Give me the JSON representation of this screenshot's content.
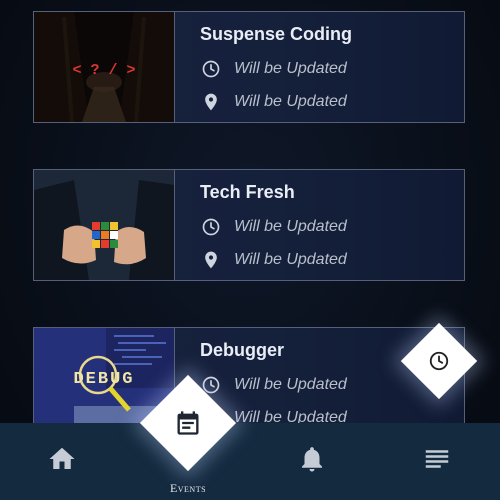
{
  "events": [
    {
      "title": "Suspense Coding",
      "time": "Will be Updated",
      "location": "Will be Updated",
      "thumb_text": "< ? / >"
    },
    {
      "title": "Tech Fresh",
      "time": "Will be Updated",
      "location": "Will be Updated"
    },
    {
      "title": "Debugger",
      "time": "Will be Updated",
      "location": "Will be Updated",
      "thumb_text": "DEBUG"
    }
  ],
  "bottom_nav": {
    "active_label": "Events",
    "items": [
      {
        "icon": "home-icon"
      },
      {
        "icon": "calendar-icon"
      },
      {
        "icon": "bell-icon"
      },
      {
        "icon": "menu-icon"
      }
    ]
  },
  "fab": {
    "icon": "clock-icon"
  },
  "colors": {
    "nav_bg": "#132a3f",
    "card_border": "#56607a",
    "card_bg": "#17223f",
    "title": "#e9edf5",
    "meta": "#b9c0cc"
  }
}
